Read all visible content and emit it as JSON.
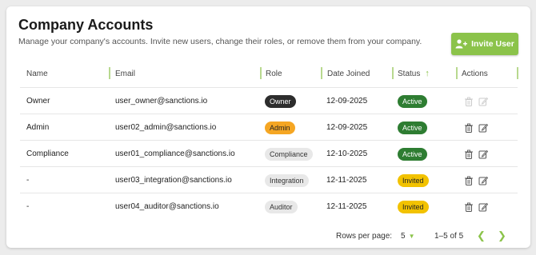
{
  "header": {
    "title": "Company Accounts",
    "subtitle": "Manage your company's accounts. Invite new users, change their roles, or remove them from your company.",
    "invite_label": "Invite User",
    "invite_icon": "add-user-icon"
  },
  "table": {
    "columns": [
      "Name",
      "Email",
      "Role",
      "Date Joined",
      "Status",
      "Actions"
    ],
    "sorted_column": "Status",
    "sort_direction": "ascending",
    "rows": [
      {
        "name": "Owner",
        "email": "user_owner@sanctions.io",
        "role": "Owner",
        "role_style": "dark",
        "date": "12-09-2025",
        "status": "Active",
        "actions_enabled": false
      },
      {
        "name": "Admin",
        "email": "user02_admin@sanctions.io",
        "role": "Admin",
        "role_style": "orange",
        "date": "12-09-2025",
        "status": "Active",
        "actions_enabled": true
      },
      {
        "name": "Compliance",
        "email": "user01_compliance@sanctions.io",
        "role": "Compliance",
        "role_style": "grey",
        "date": "12-10-2025",
        "status": "Active",
        "actions_enabled": true
      },
      {
        "name": "-",
        "email": "user03_integration@sanctions.io",
        "role": "Integration",
        "role_style": "grey",
        "date": "12-11-2025",
        "status": "Invited",
        "actions_enabled": true
      },
      {
        "name": "-",
        "email": "user04_auditor@sanctions.io",
        "role": "Auditor",
        "role_style": "grey",
        "date": "12-11-2025",
        "status": "Invited",
        "actions_enabled": true
      }
    ]
  },
  "pagination": {
    "rows_per_page_label": "Rows per page:",
    "rows_per_page": "5",
    "range": "1–5 of 5"
  },
  "colors": {
    "accent": "#8bc34a",
    "active": "#2e7d32",
    "invited": "#f2c200",
    "admin": "#f5a623",
    "owner": "#2d2d2d"
  }
}
